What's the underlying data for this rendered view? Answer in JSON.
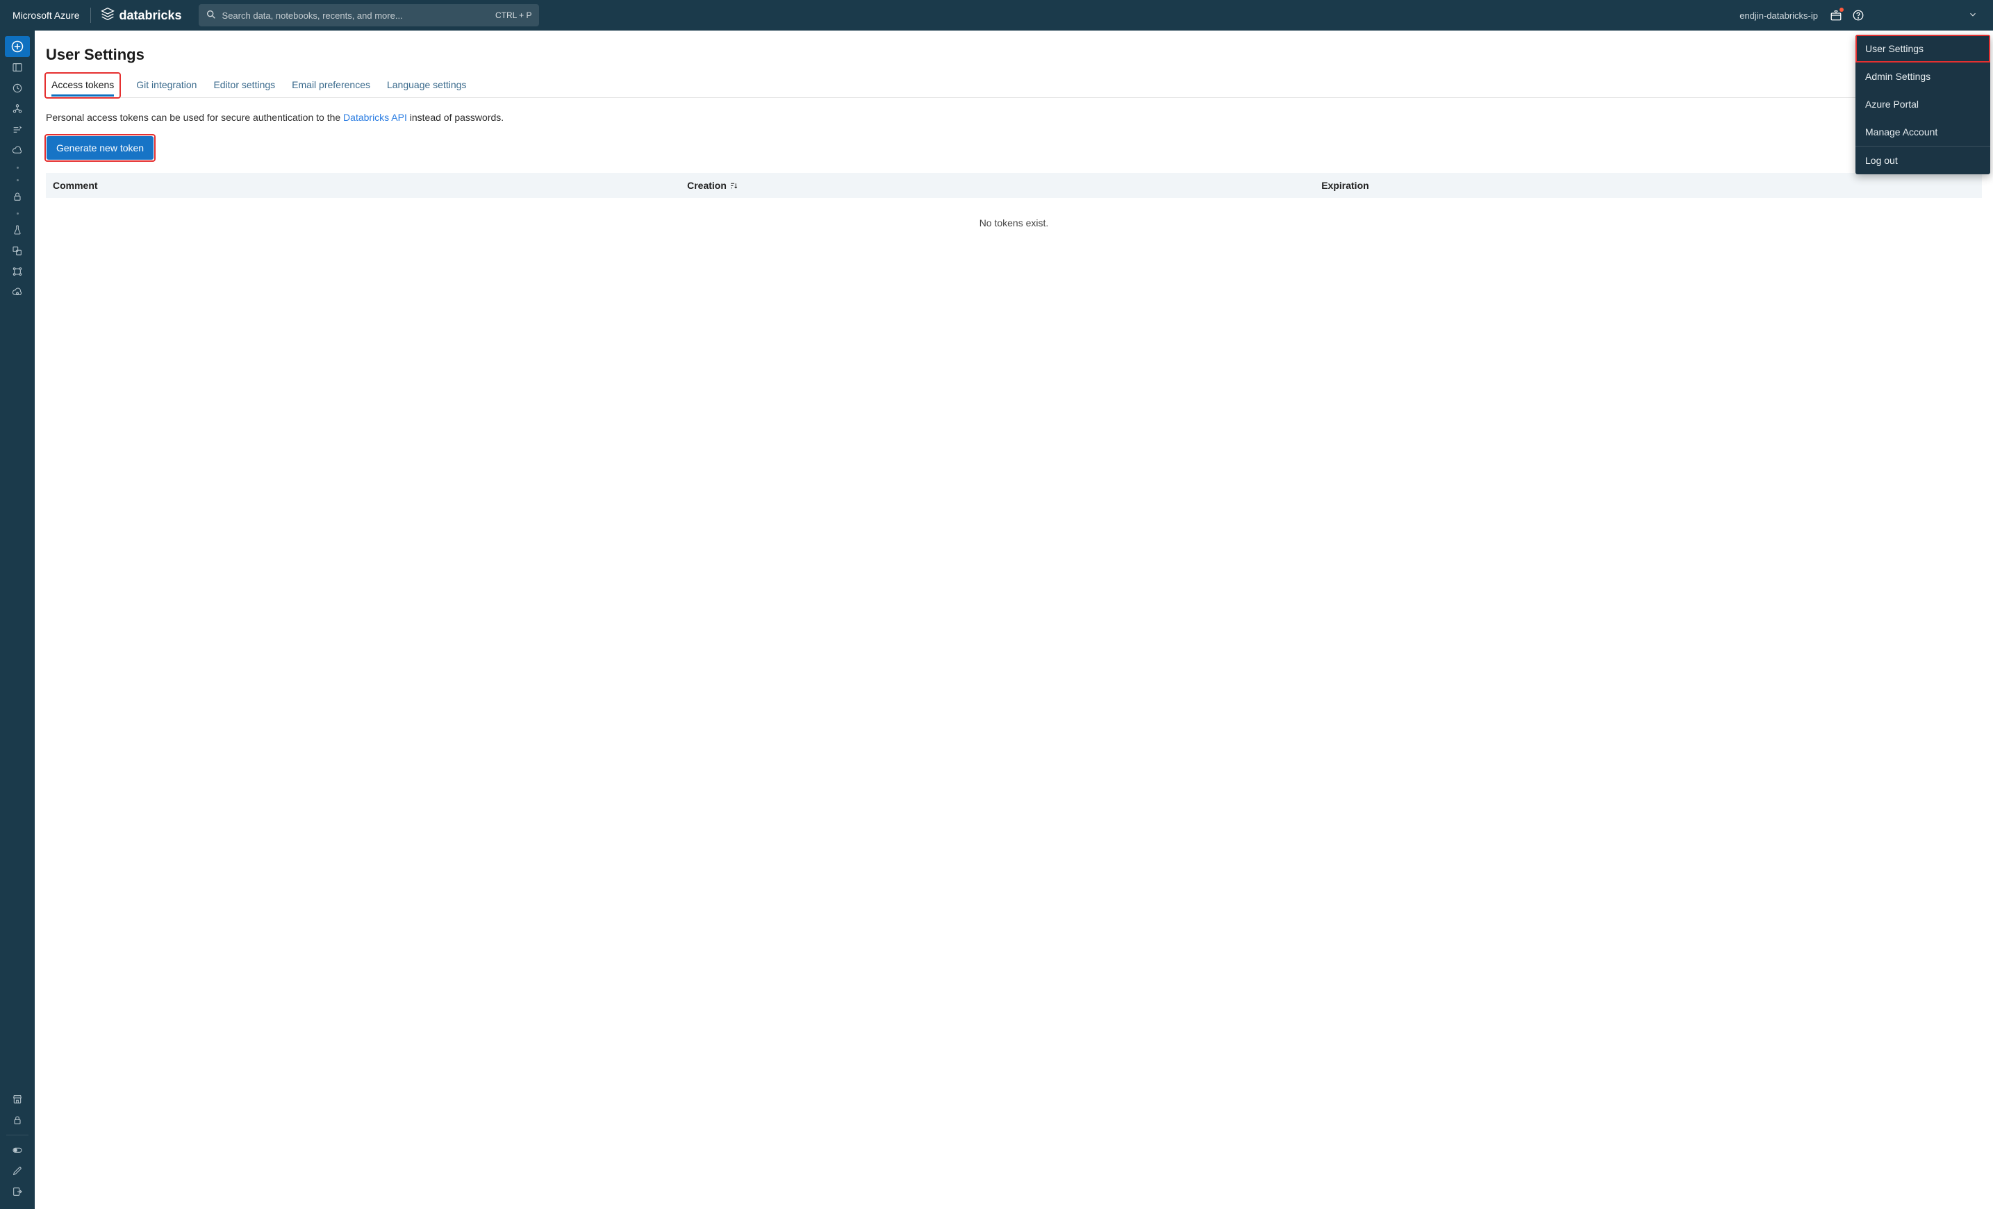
{
  "header": {
    "azure_brand": "Microsoft Azure",
    "databricks_brand": "databricks",
    "search_placeholder": "Search data, notebooks, recents, and more...",
    "search_shortcut": "CTRL + P",
    "workspace_name": "endjin-databricks-ip"
  },
  "rail": {
    "items": [
      {
        "name": "create",
        "icon": "plus-circle",
        "selected": true
      },
      {
        "name": "workspace",
        "icon": "panel"
      },
      {
        "name": "recents",
        "icon": "clock"
      },
      {
        "name": "data",
        "icon": "data-tree"
      },
      {
        "name": "workflows",
        "icon": "workflows"
      },
      {
        "name": "compute",
        "icon": "cloud"
      },
      {
        "type": "dot"
      },
      {
        "type": "dot"
      },
      {
        "name": "secrets",
        "icon": "lock"
      },
      {
        "type": "dot"
      },
      {
        "name": "experiments",
        "icon": "flask"
      },
      {
        "name": "models",
        "icon": "models"
      },
      {
        "name": "feature-store",
        "icon": "feature"
      },
      {
        "name": "serving",
        "icon": "serving"
      }
    ],
    "bottom": [
      {
        "name": "marketplace",
        "icon": "store"
      },
      {
        "name": "secrets-bottom",
        "icon": "lock"
      }
    ],
    "footer": [
      {
        "name": "toggle",
        "icon": "toggle"
      },
      {
        "name": "edit",
        "icon": "pencil"
      },
      {
        "name": "signout",
        "icon": "signout"
      }
    ]
  },
  "page": {
    "title": "User Settings",
    "tabs": [
      {
        "label": "Access tokens",
        "active": true,
        "highlight": true
      },
      {
        "label": "Git integration"
      },
      {
        "label": "Editor settings"
      },
      {
        "label": "Email preferences"
      },
      {
        "label": "Language settings"
      }
    ],
    "description_prefix": "Personal access tokens can be used for secure authentication to the ",
    "description_link": "Databricks API",
    "description_suffix": " instead of passwords.",
    "generate_button": "Generate new token",
    "table": {
      "headers": {
        "comment": "Comment",
        "creation": "Creation",
        "expiration": "Expiration"
      },
      "empty": "No tokens exist."
    }
  },
  "user_menu": [
    {
      "label": "User Settings",
      "highlight": true
    },
    {
      "label": "Admin Settings"
    },
    {
      "label": "Azure Portal"
    },
    {
      "label": "Manage Account"
    },
    {
      "type": "sep"
    },
    {
      "label": "Log out"
    }
  ]
}
